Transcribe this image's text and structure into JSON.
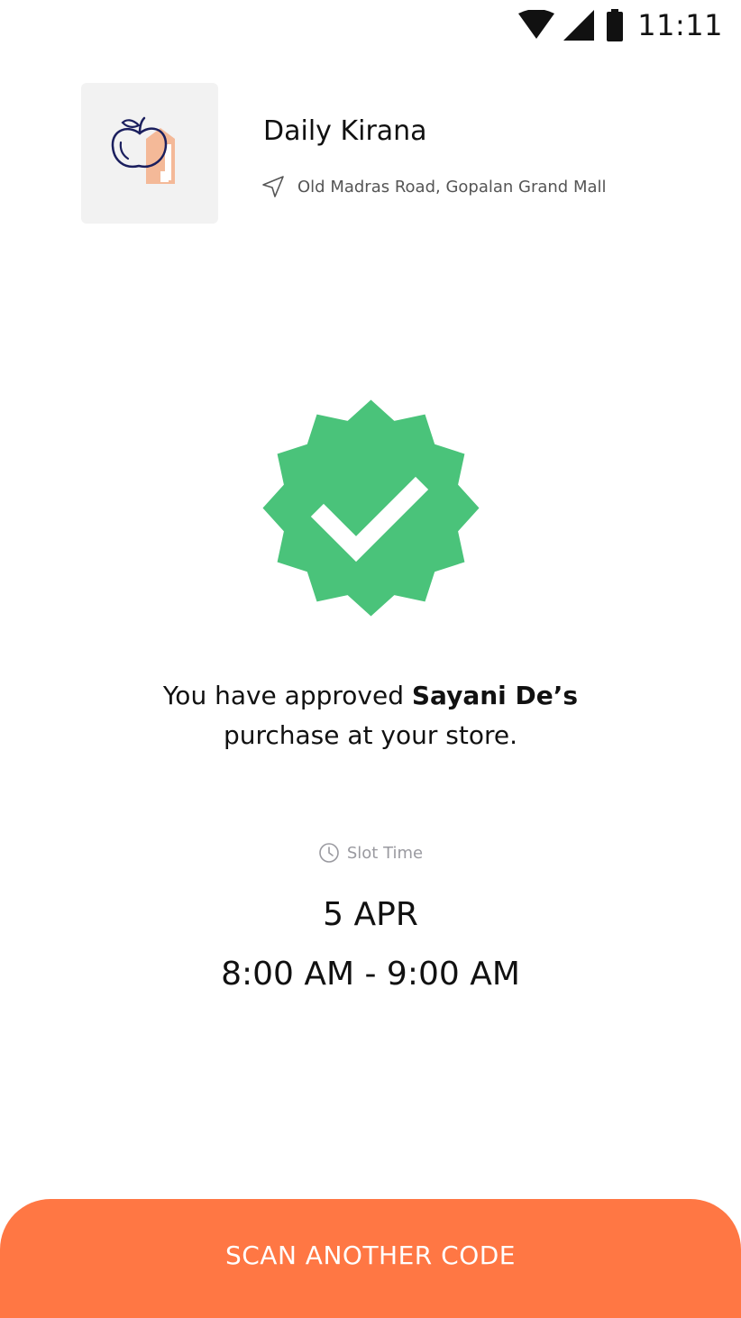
{
  "status_bar": {
    "time": "11:11",
    "icons": [
      "wifi-icon",
      "signal-icon",
      "battery-icon"
    ]
  },
  "store": {
    "name": "Daily Kirana",
    "address": "Old Madras Road, Gopalan Grand Mall",
    "thumbnail_icon": "grocery-icon",
    "address_icon": "navigation-arrow-icon"
  },
  "confirmation": {
    "icon": "verified-badge-icon",
    "message_prefix": "You have approved ",
    "customer_name": "Sayani De’s",
    "message_suffix": "purchase at your store."
  },
  "slot": {
    "label": "Slot Time",
    "icon": "clock-icon",
    "date": "5 APR",
    "time_range": "8:00 AM - 9:00 AM"
  },
  "actions": {
    "scan_button_label": "SCAN ANOTHER CODE"
  },
  "colors": {
    "accent": "#FF7744",
    "success": "#4AC37A",
    "icon_navy": "#1B1F5E",
    "icon_peach": "#F4B998",
    "thumb_bg": "#F2F2F2",
    "muted_text": "#9A9AA0"
  }
}
